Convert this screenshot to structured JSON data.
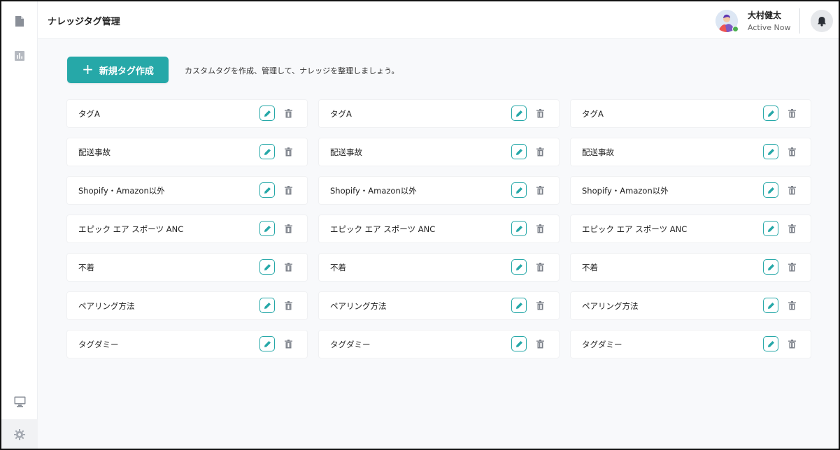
{
  "header": {
    "title": "ナレッジタグ管理",
    "user": {
      "name": "大村健太",
      "status": "Active Now"
    }
  },
  "main": {
    "new_tag_label": "新規タグ作成",
    "intro": "カスタムタグを作成、管理して、ナレッジを整理しましょう。",
    "tags": [
      "タグA",
      "タグA",
      "タグA",
      "配送事故",
      "配送事故",
      "配送事故",
      "Shopify・Amazon以外",
      "Shopify・Amazon以外",
      "Shopify・Amazon以外",
      "エピック エア スポーツ ANC",
      "エピック エア スポーツ ANC",
      "エピック エア スポーツ ANC",
      "不着",
      "不着",
      "不着",
      "ペアリング方法",
      "ペアリング方法",
      "ペアリング方法",
      "タグダミー",
      "タグダミー",
      "タグダミー"
    ]
  },
  "colors": {
    "accent": "#26a8a8",
    "background": "#f8f9fb",
    "status_online": "#4caf50"
  },
  "icons": {
    "sidebar": [
      "document-icon",
      "chart-icon",
      "monitor-icon",
      "gear-icon"
    ],
    "header": [
      "bell-icon"
    ],
    "card": [
      "pencil-icon",
      "trash-icon"
    ]
  }
}
